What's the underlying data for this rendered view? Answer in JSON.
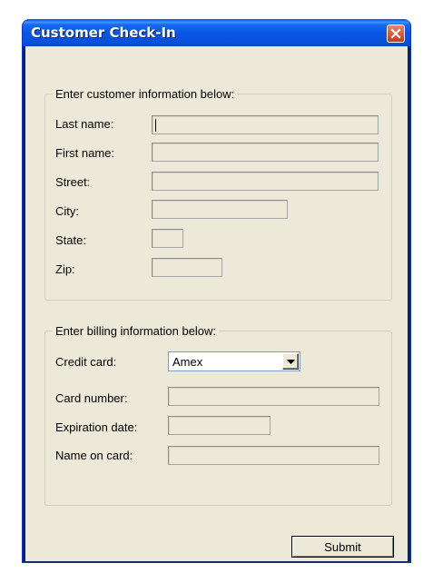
{
  "window": {
    "title": "Customer Check-In"
  },
  "customer_group": {
    "legend": "Enter customer information below:",
    "fields": {
      "last_name": {
        "label": "Last name:",
        "value": ""
      },
      "first_name": {
        "label": "First name:",
        "value": ""
      },
      "street": {
        "label": "Street:",
        "value": ""
      },
      "city": {
        "label": "City:",
        "value": ""
      },
      "state": {
        "label": "State:",
        "value": ""
      },
      "zip": {
        "label": "Zip:",
        "value": ""
      }
    }
  },
  "billing_group": {
    "legend": "Enter billing information below:",
    "credit_card": {
      "label": "Credit card:",
      "selected": "Amex"
    },
    "fields": {
      "card_number": {
        "label": "Card number:",
        "value": ""
      },
      "expiration_date": {
        "label": "Expiration date:",
        "value": ""
      },
      "name_on_card": {
        "label": "Name on card:",
        "value": ""
      }
    }
  },
  "actions": {
    "submit_label": "Submit"
  },
  "icons": {
    "close": "close-icon",
    "dropdown": "chevron-down-icon"
  },
  "colors": {
    "titlebar": "#0a55e5",
    "close_button": "#e25a32",
    "dialog_background": "#ece9d8"
  }
}
